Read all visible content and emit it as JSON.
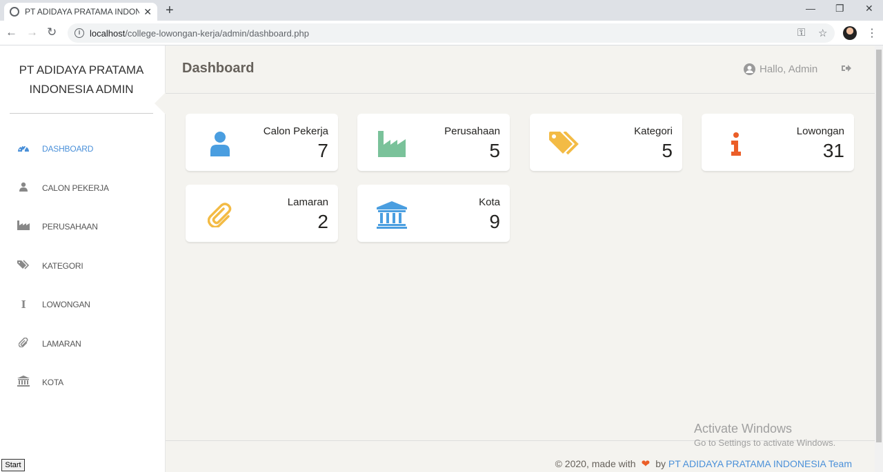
{
  "browser": {
    "tab_title": "PT ADIDAYA PRATAMA INDONESIA ADMIN",
    "url_host": "localhost",
    "url_path": "/college-lowongan-kerja/admin/dashboard.php"
  },
  "sidebar": {
    "brand": "PT ADIDAYA PRATAMA INDONESIA ADMIN",
    "items": [
      {
        "label": "DASHBOARD",
        "icon": "dashboard-icon",
        "active": true
      },
      {
        "label": "CALON PEKERJA",
        "icon": "user-icon",
        "active": false
      },
      {
        "label": "PERUSAHAAN",
        "icon": "industry-icon",
        "active": false
      },
      {
        "label": "KATEGORI",
        "icon": "tags-icon",
        "active": false
      },
      {
        "label": "LOWONGAN",
        "icon": "info-icon",
        "active": false
      },
      {
        "label": "LAMARAN",
        "icon": "paperclip-icon",
        "active": false
      },
      {
        "label": "KOTA",
        "icon": "bank-icon",
        "active": false
      }
    ]
  },
  "header": {
    "title": "Dashboard",
    "greeting": "Hallo, Admin"
  },
  "cards": [
    {
      "label": "Calon Pekerja",
      "value": "7",
      "icon": "user-icon",
      "color": "#4a9ee0"
    },
    {
      "label": "Perusahaan",
      "value": "5",
      "icon": "industry-icon",
      "color": "#7ac29a"
    },
    {
      "label": "Kategori",
      "value": "5",
      "icon": "tags-icon",
      "color": "#f3bb45"
    },
    {
      "label": "Lowongan",
      "value": "31",
      "icon": "info-icon",
      "color": "#eb5e28"
    },
    {
      "label": "Lamaran",
      "value": "2",
      "icon": "paperclip-icon",
      "color": "#f3bb45"
    },
    {
      "label": "Kota",
      "value": "9",
      "icon": "bank-icon",
      "color": "#4a9ee0"
    }
  ],
  "footer": {
    "prefix": "© 2020, made with",
    "by": "by",
    "team": "PT ADIDAYA PRATAMA INDONESIA Team"
  },
  "watermark": {
    "line1": "Activate Windows",
    "line2": "Go to Settings to activate Windows."
  },
  "taskbar": {
    "start": "Start"
  }
}
